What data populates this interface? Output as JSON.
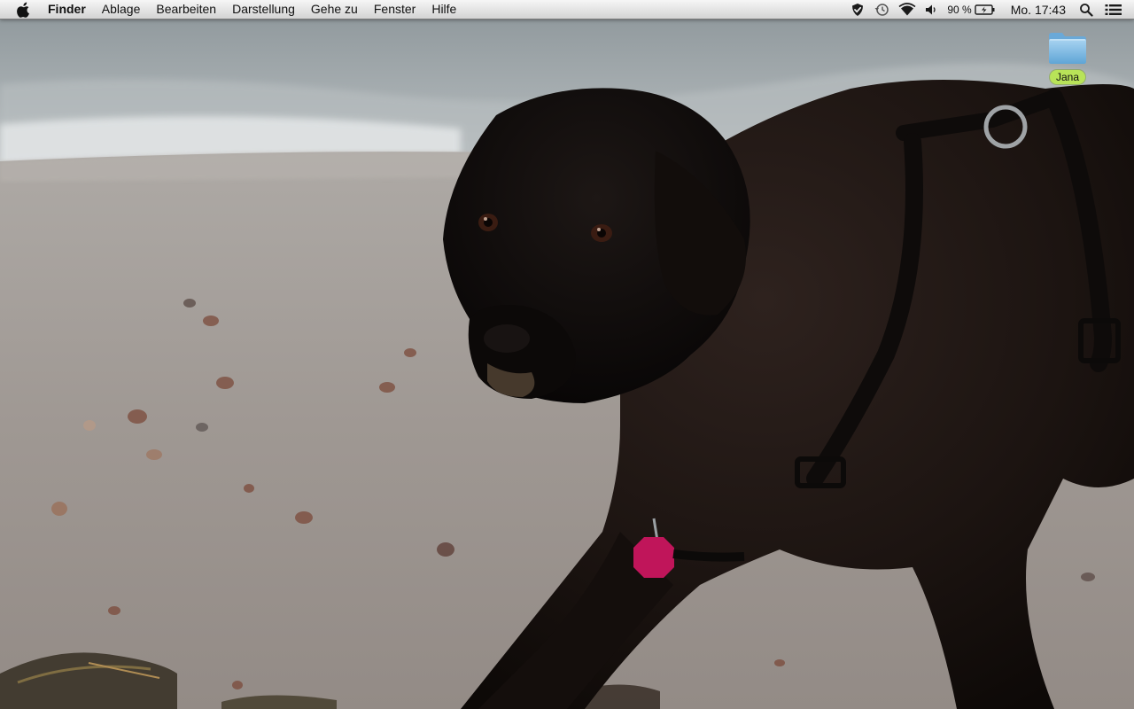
{
  "menubar": {
    "apple_icon": "apple-logo-icon",
    "app_name": "Finder",
    "menus": [
      "Ablage",
      "Bearbeiten",
      "Darstellung",
      "Gehe zu",
      "Fenster",
      "Hilfe"
    ],
    "status_icons": [
      "shield-check-icon",
      "time-machine-icon",
      "wifi-icon",
      "volume-icon"
    ],
    "battery_percent": "90 %",
    "clock": "Mo. 17:43",
    "spotlight_icon": "spotlight-search-icon",
    "notification_icon": "notification-center-icon"
  },
  "desktop": {
    "wallpaper": "black dog on beach",
    "icons": [
      {
        "label": "Jana",
        "kind": "folder-icon",
        "label_color": "#b8e358"
      }
    ]
  }
}
